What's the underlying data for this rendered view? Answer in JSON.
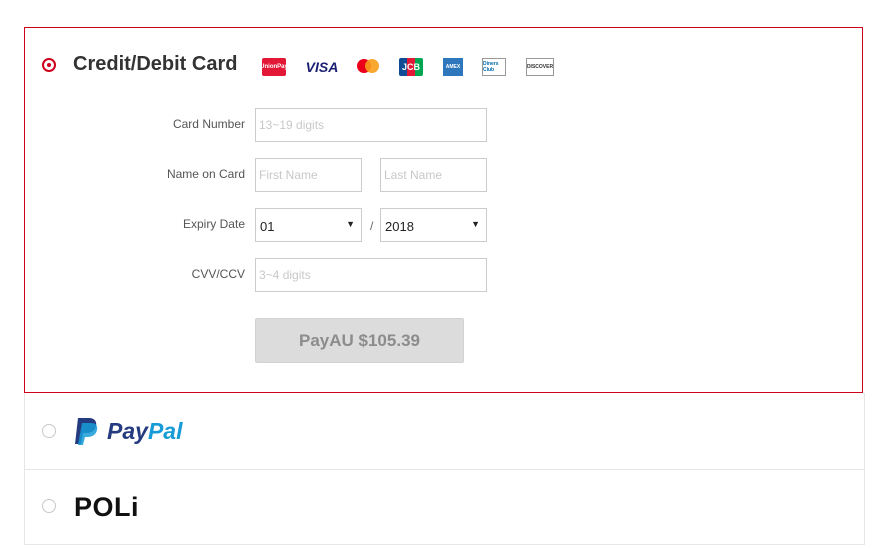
{
  "card_option": {
    "title": "Credit/Debit Card",
    "selected": true,
    "brands": [
      {
        "name": "UnionPay",
        "text": "UnionPay"
      },
      {
        "name": "Visa",
        "text": "VISA"
      },
      {
        "name": "Mastercard",
        "text": "mastercard"
      },
      {
        "name": "JCB",
        "text": "JCB"
      },
      {
        "name": "American Express",
        "text": "AMEX"
      },
      {
        "name": "Diners Club",
        "text": "Diners Club"
      },
      {
        "name": "Discover",
        "text": "DISCOVER"
      }
    ]
  },
  "form": {
    "card_number_label": "Card Number",
    "card_number_placeholder": "13~19 digits",
    "name_label": "Name on Card",
    "first_name_placeholder": "First Name",
    "last_name_placeholder": "Last Name",
    "expiry_label": "Expiry Date",
    "expiry_month": "01",
    "expiry_separator": "/",
    "expiry_year": "2018",
    "cvv_label": "CVV/CCV",
    "cvv_placeholder": "3~4 digits",
    "pay_button_label": "PayAU $105.39"
  },
  "paypal_option": {
    "logo_text_dark": "Pay",
    "logo_text_light": "Pal",
    "selected": false
  },
  "poli_option": {
    "logo_text": "POLi",
    "selected": false
  },
  "colors": {
    "accent": "#d0021b",
    "paypal_dark": "#253b80",
    "paypal_light": "#179bd7"
  }
}
